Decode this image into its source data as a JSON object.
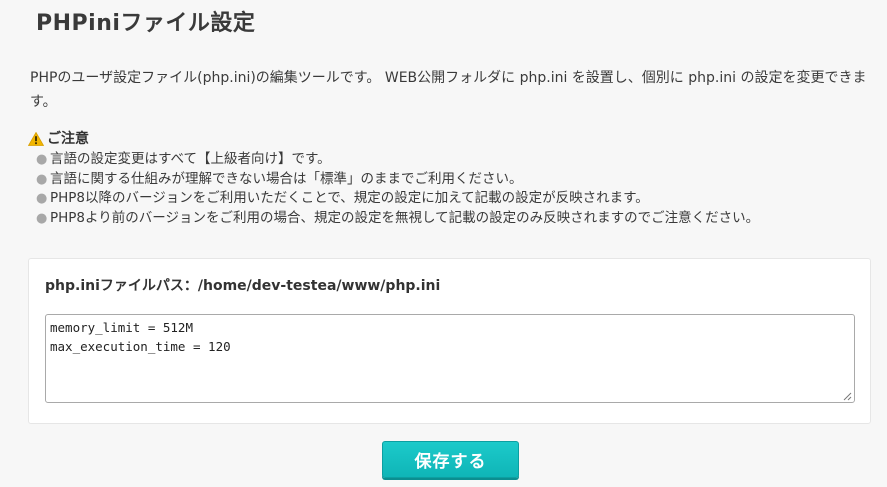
{
  "page": {
    "title": "PHPiniファイル設定",
    "description": "PHPのユーザ設定ファイル(php.ini)の編集ツールです。 WEB公開フォルダに php.ini を設置し、個別に php.ini の設定を変更できます。"
  },
  "notice": {
    "heading": "ご注意",
    "icon": "warning-icon",
    "icon_color": "#f2b600",
    "items": [
      "言語の設定変更はすべて【上級者向け】です。",
      "言語に関する仕組みが理解できない場合は「標準」のままでご利用ください。",
      "PHP8以降のバージョンをご利用いただくことで、規定の設定に加えて記載の設定が反映されます。",
      "PHP8より前のバージョンをご利用の場合、規定の設定を無視して記載の設定のみ反映されますのでご注意ください。"
    ]
  },
  "editor": {
    "path_label": "php.iniファイルパス：/home/dev-testea/www/php.ini",
    "content": "memory_limit = 512M\nmax_execution_time = 120"
  },
  "actions": {
    "save_label": "保存する",
    "save_color": "#13c2c2"
  }
}
